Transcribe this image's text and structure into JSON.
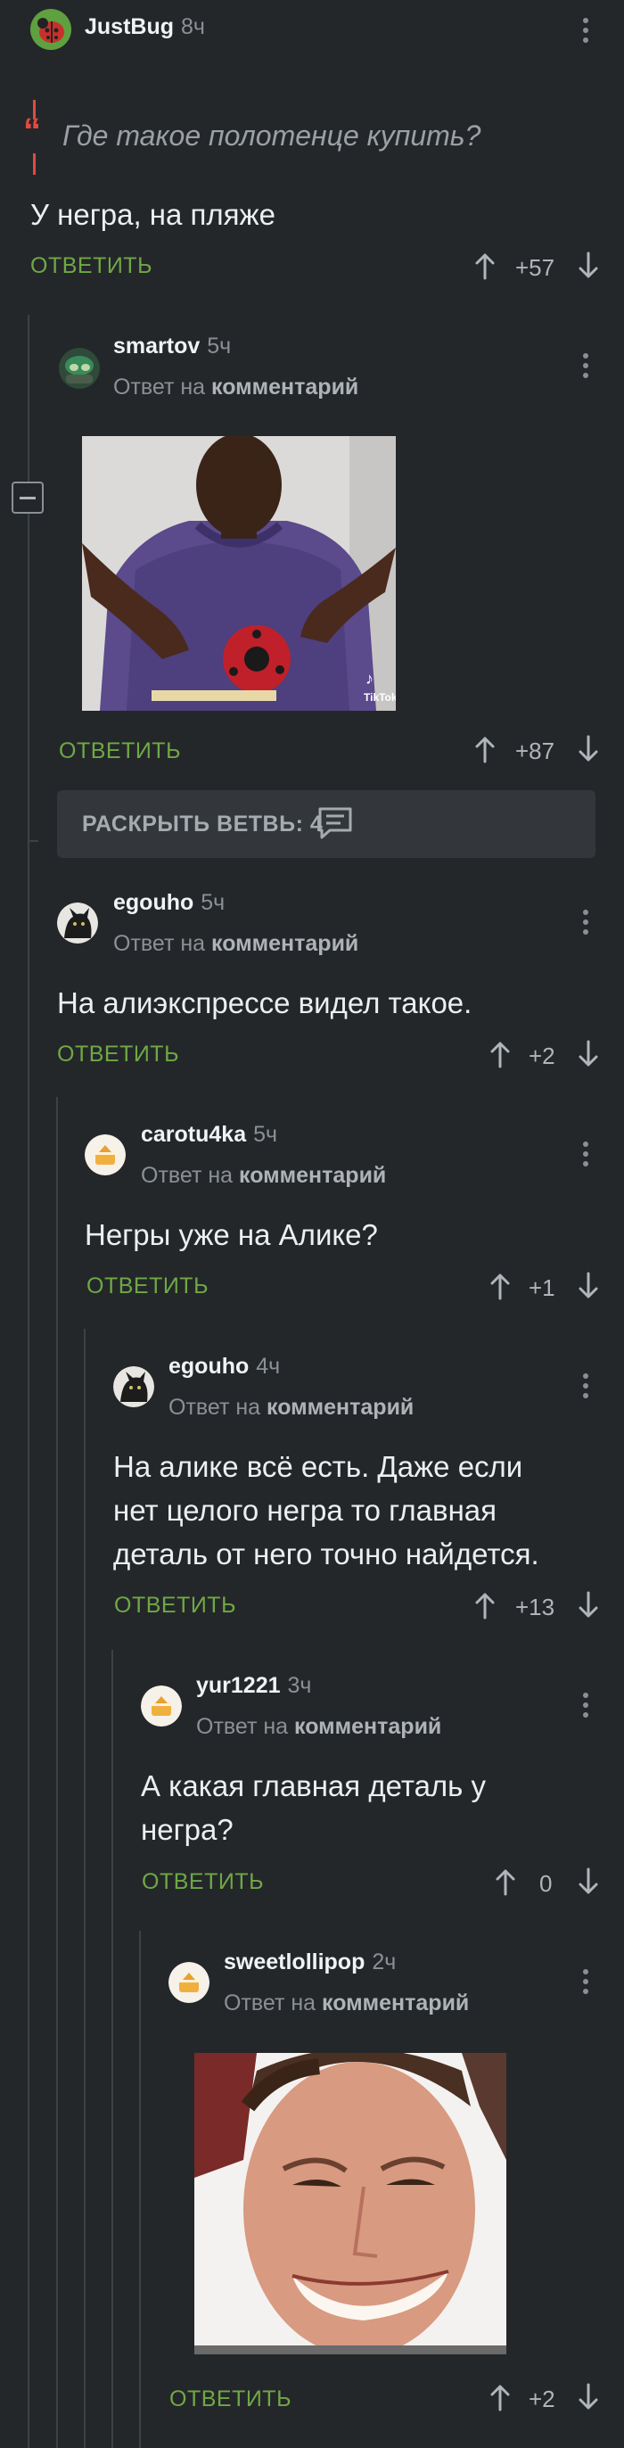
{
  "comments": {
    "root": {
      "author": "JustBug",
      "time": "8ч",
      "quote": "Где такое полотенце купить?",
      "text": "У негра, на пляже",
      "answer": "ОТВЕТИТЬ",
      "rating": "+57"
    },
    "smartov": {
      "author": "smartov",
      "time": "5ч",
      "reply_prefix": "Ответ на",
      "reply_target": "комментарий",
      "image_label": "TikTok",
      "answer": "ОТВЕТИТЬ",
      "rating": "+87",
      "expand": "РАСКРЫТЬ ВЕТВЬ: 4"
    },
    "egouho1": {
      "author": "egouho",
      "time": "5ч",
      "reply_prefix": "Ответ на",
      "reply_target": "комментарий",
      "text": "На алиэкспрессе видел такое.",
      "answer": "ОТВЕТИТЬ",
      "rating": "+2"
    },
    "carotu4ka": {
      "author": "carotu4ka",
      "time": "5ч",
      "reply_prefix": "Ответ на",
      "reply_target": "комментарий",
      "text": "Негры уже на Алике?",
      "answer": "ОТВЕТИТЬ",
      "rating": "+1"
    },
    "egouho2": {
      "author": "egouho",
      "time": "4ч",
      "reply_prefix": "Ответ на",
      "reply_target": "комментарий",
      "text_lines": [
        "На алике всё есть. Даже если",
        "нет целого негра то главная",
        "деталь от него точно найдется."
      ],
      "answer": "ОТВЕТИТЬ",
      "rating": "+13"
    },
    "yur1221": {
      "author": "yur1221",
      "time": "3ч",
      "reply_prefix": "Ответ на",
      "reply_target": "комментарий",
      "text_lines": [
        "А какая главная деталь у",
        "негра?"
      ],
      "answer": "ОТВЕТИТЬ",
      "rating": "0"
    },
    "sweetlollipop": {
      "author": "sweetlollipop",
      "time": "2ч",
      "reply_prefix": "Ответ на",
      "reply_target": "комментарий",
      "answer": "ОТВЕТИТЬ",
      "rating": "+2"
    }
  },
  "colors": {
    "background": "#24272a",
    "accent_green": "#6fa845",
    "quote_red": "#e14a3f",
    "thread_line": "#3c4145"
  },
  "icons": {
    "more": "kebab-icon",
    "upvote": "arrow-up-icon",
    "downvote": "arrow-down-icon",
    "collapse": "minus-box-icon",
    "branch": "comment-icon"
  }
}
